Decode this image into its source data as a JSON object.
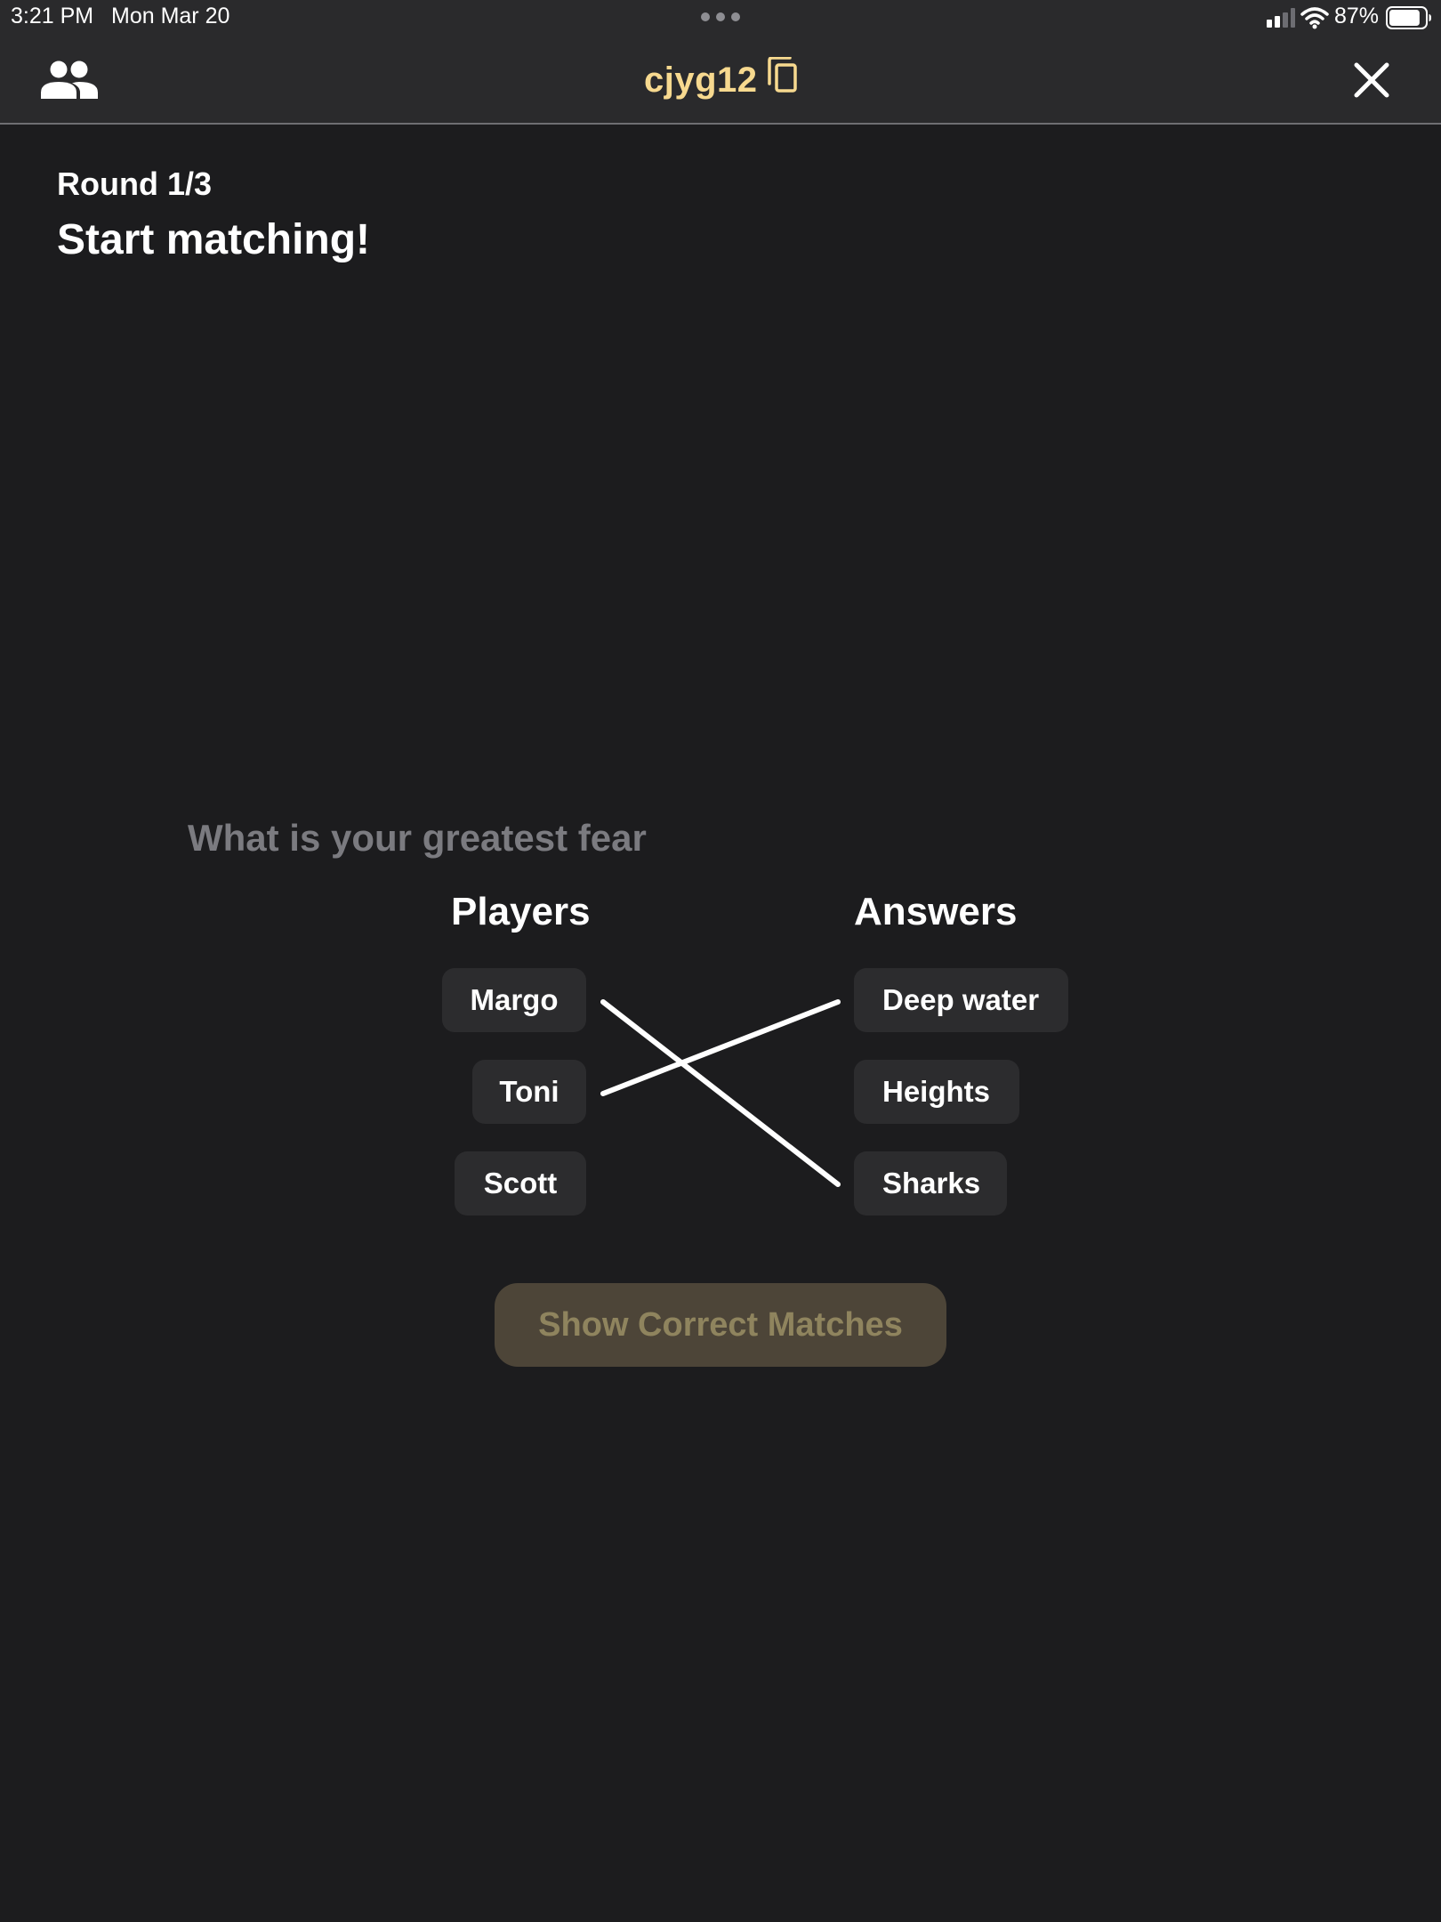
{
  "status_bar": {
    "time": "3:21 PM",
    "date": "Mon Mar 20",
    "battery_percent": "87%",
    "battery_level": 0.87,
    "icons": [
      "multitask-dots-icon",
      "cellular-signal-icon",
      "wifi-icon",
      "battery-icon"
    ]
  },
  "nav": {
    "room_code": "cjyg12",
    "icons": {
      "players": "people-icon",
      "copy": "copy-icon",
      "close": "close-icon"
    },
    "accent_color": "#f7d98f"
  },
  "round": {
    "label": "Round 1/3",
    "title": "Start matching!"
  },
  "game": {
    "question": "What is your greatest fear",
    "players_header": "Players",
    "answers_header": "Answers",
    "players": [
      "Margo",
      "Toni",
      "Scott"
    ],
    "answers": [
      "Deep water",
      "Heights",
      "Sharks"
    ],
    "matches": [
      {
        "player": "Margo",
        "answer": "Sharks"
      },
      {
        "player": "Toni",
        "answer": "Deep water"
      }
    ],
    "show_button_label": "Show Correct Matches"
  }
}
